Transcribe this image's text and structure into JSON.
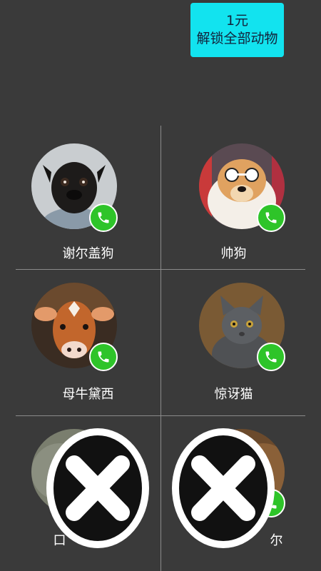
{
  "unlock": {
    "price": "1元",
    "label": "解锁全部动物"
  },
  "animals": [
    {
      "name": "谢尔盖狗",
      "icon": "pug-photo"
    },
    {
      "name": "帅狗",
      "icon": "chow-dog-sunglasses-photo"
    },
    {
      "name": "母牛黛西",
      "icon": "cow-photo"
    },
    {
      "name": "惊讶猫",
      "icon": "gray-cat-photo"
    },
    {
      "name": "口",
      "icon": "animal-photo-partially-hidden"
    },
    {
      "name": "尔",
      "icon": "animal-photo-partially-hidden"
    }
  ],
  "colors": {
    "background": "#3a3a3a",
    "unlock_button": "#12e3ef",
    "call_badge": "#2ec429"
  },
  "overlay_icons": [
    "close-icon",
    "close-icon"
  ]
}
